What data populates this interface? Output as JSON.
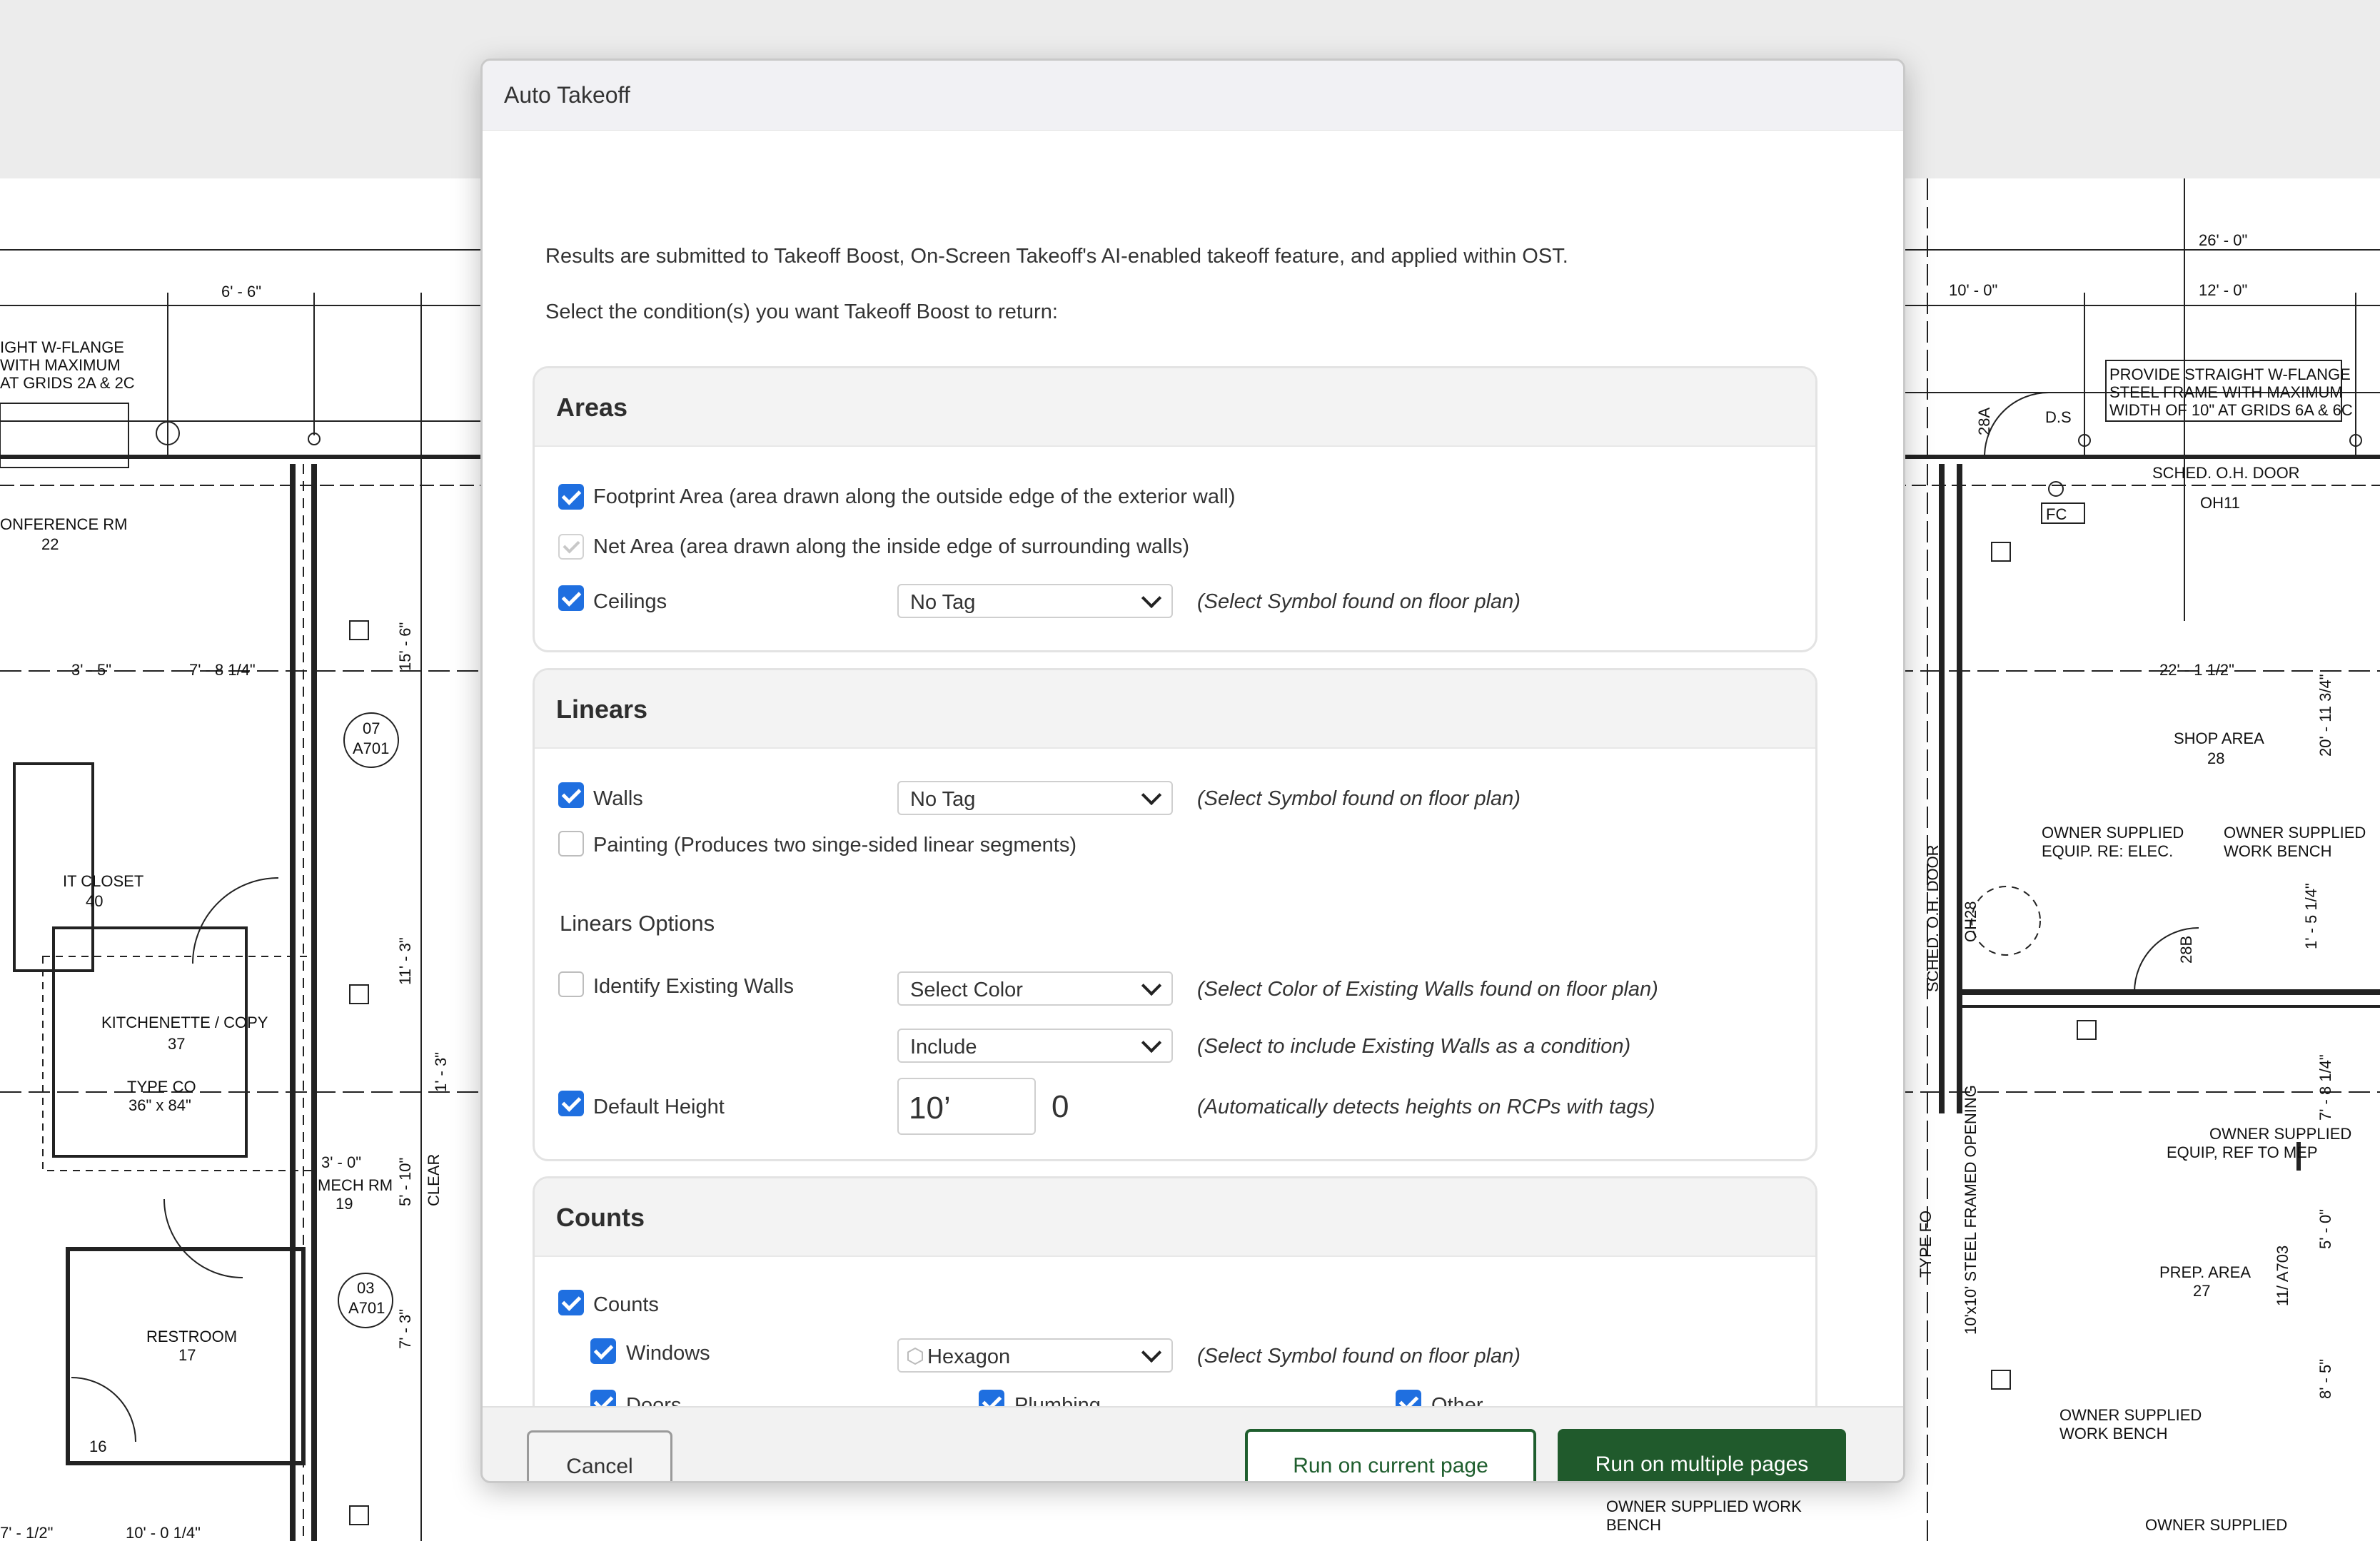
{
  "dialog": {
    "title": "Auto Takeoff",
    "intro_line1": "Results are submitted to Takeoff Boost, On-Screen Takeoff's AI-enabled takeoff feature, and applied within OST.",
    "intro_line2": "Select the condition(s) you want Takeoff Boost to return:"
  },
  "areas": {
    "heading": "Areas",
    "footprint": {
      "label": "Footprint Area (area drawn along the outside edge of the exterior wall)",
      "checked": true
    },
    "net": {
      "label": "Net Area (area drawn along the inside edge of surrounding walls)",
      "checked": true,
      "disabled": true
    },
    "ceilings": {
      "label": "Ceilings",
      "checked": true,
      "select_value": "No Tag",
      "hint": "(Select Symbol found on floor plan)"
    }
  },
  "linears": {
    "heading": "Linears",
    "walls": {
      "label": "Walls",
      "checked": true,
      "select_value": "No Tag",
      "hint": "(Select Symbol found on floor plan)"
    },
    "painting": {
      "label": "Painting (Produces two singe-sided linear segments)",
      "checked": false
    },
    "options_heading": "Linears Options",
    "existing": {
      "label": "Identify Existing Walls",
      "checked": false,
      "select_value": "Select Color",
      "hint": "(Select Color of Existing Walls found on floor plan)"
    },
    "include": {
      "select_value": "Include",
      "hint": "(Select to include Existing Walls as a condition)"
    },
    "height": {
      "label": "Default Height",
      "checked": true,
      "feet": "10’",
      "inches": "0",
      "hint": "(Automatically detects heights on RCPs with tags)"
    }
  },
  "counts": {
    "heading": "Counts",
    "counts": {
      "label": "Counts",
      "checked": true
    },
    "windows": {
      "label": "Windows",
      "checked": true,
      "select_value": "Hexagon",
      "hint": "(Select Symbol found on floor plan)"
    },
    "doors": {
      "label": "Doors",
      "checked": true
    },
    "plumbing": {
      "label": "Plumbing",
      "checked": true
    },
    "other": {
      "label": "Other",
      "checked": true
    }
  },
  "footer": {
    "cancel": "Cancel",
    "run_current": "Run on current page",
    "run_multiple": "Run on multiple pages"
  },
  "plan": {
    "left_labels": [
      "IGHT W-FLANGE",
      "WITH MAXIMUM",
      "AT GRIDS 2A & 2C",
      "ONFERENCE RM",
      "22",
      "6' - 6\"",
      "3' - 5\"",
      "7' - 8 1/4\"",
      "IT CLOSET",
      "40",
      "KITCHENETTE / COPY",
      "37",
      "TYPE CO",
      "36\" x 84\"",
      "MECH RM",
      "19",
      "RESTROOM",
      "17",
      "16",
      "10' - 0 1/4\"",
      "7' - 1/2\"",
      "15' - 6\"",
      "11' - 3\"",
      "1' - 3\"",
      "5' - 10\"",
      "CLEAR",
      "7' - 3\"",
      "3' - 0\"",
      "07",
      "A701",
      "03",
      "A701"
    ],
    "right_labels": [
      "26' - 0\"",
      "10' - 0\"",
      "12' - 0\"",
      "PROVIDE STRAIGHT W-FLANGE",
      "STEEL FRAME WITH MAXIMUM",
      "WIDTH OF 10\" AT GRIDS 6A & 6C",
      "D.S",
      "SCHED. O.H. DOOR",
      "OH11",
      "FC",
      "22' - 1 1/2\"",
      "SHOP AREA",
      "28",
      "SCHED. O.H. DOOR",
      "OH28",
      "OWNER SUPPLIED",
      "EQUIP. RE: ELEC.",
      "OWNER SUPPLIED",
      "WORK BENCH",
      "OWNER SUPPLIED",
      "EQUIP, REF TO MEP",
      "PREP. AREA",
      "27",
      "11/ A703",
      "10'x10' STEEL FRAMED OPENING",
      "TYPE FO",
      "OWNER SUPPLIED",
      "WORK BENCH",
      "OWNER SUPPLIED WORK",
      "BENCH",
      "OWNER SUPPLIED",
      "28A",
      "28B",
      "20' - 11 3/4\"",
      "1' - 5 1/4\"",
      "7' - 8 1/4\"",
      "5' - 0\"",
      "8' - 5\""
    ]
  }
}
